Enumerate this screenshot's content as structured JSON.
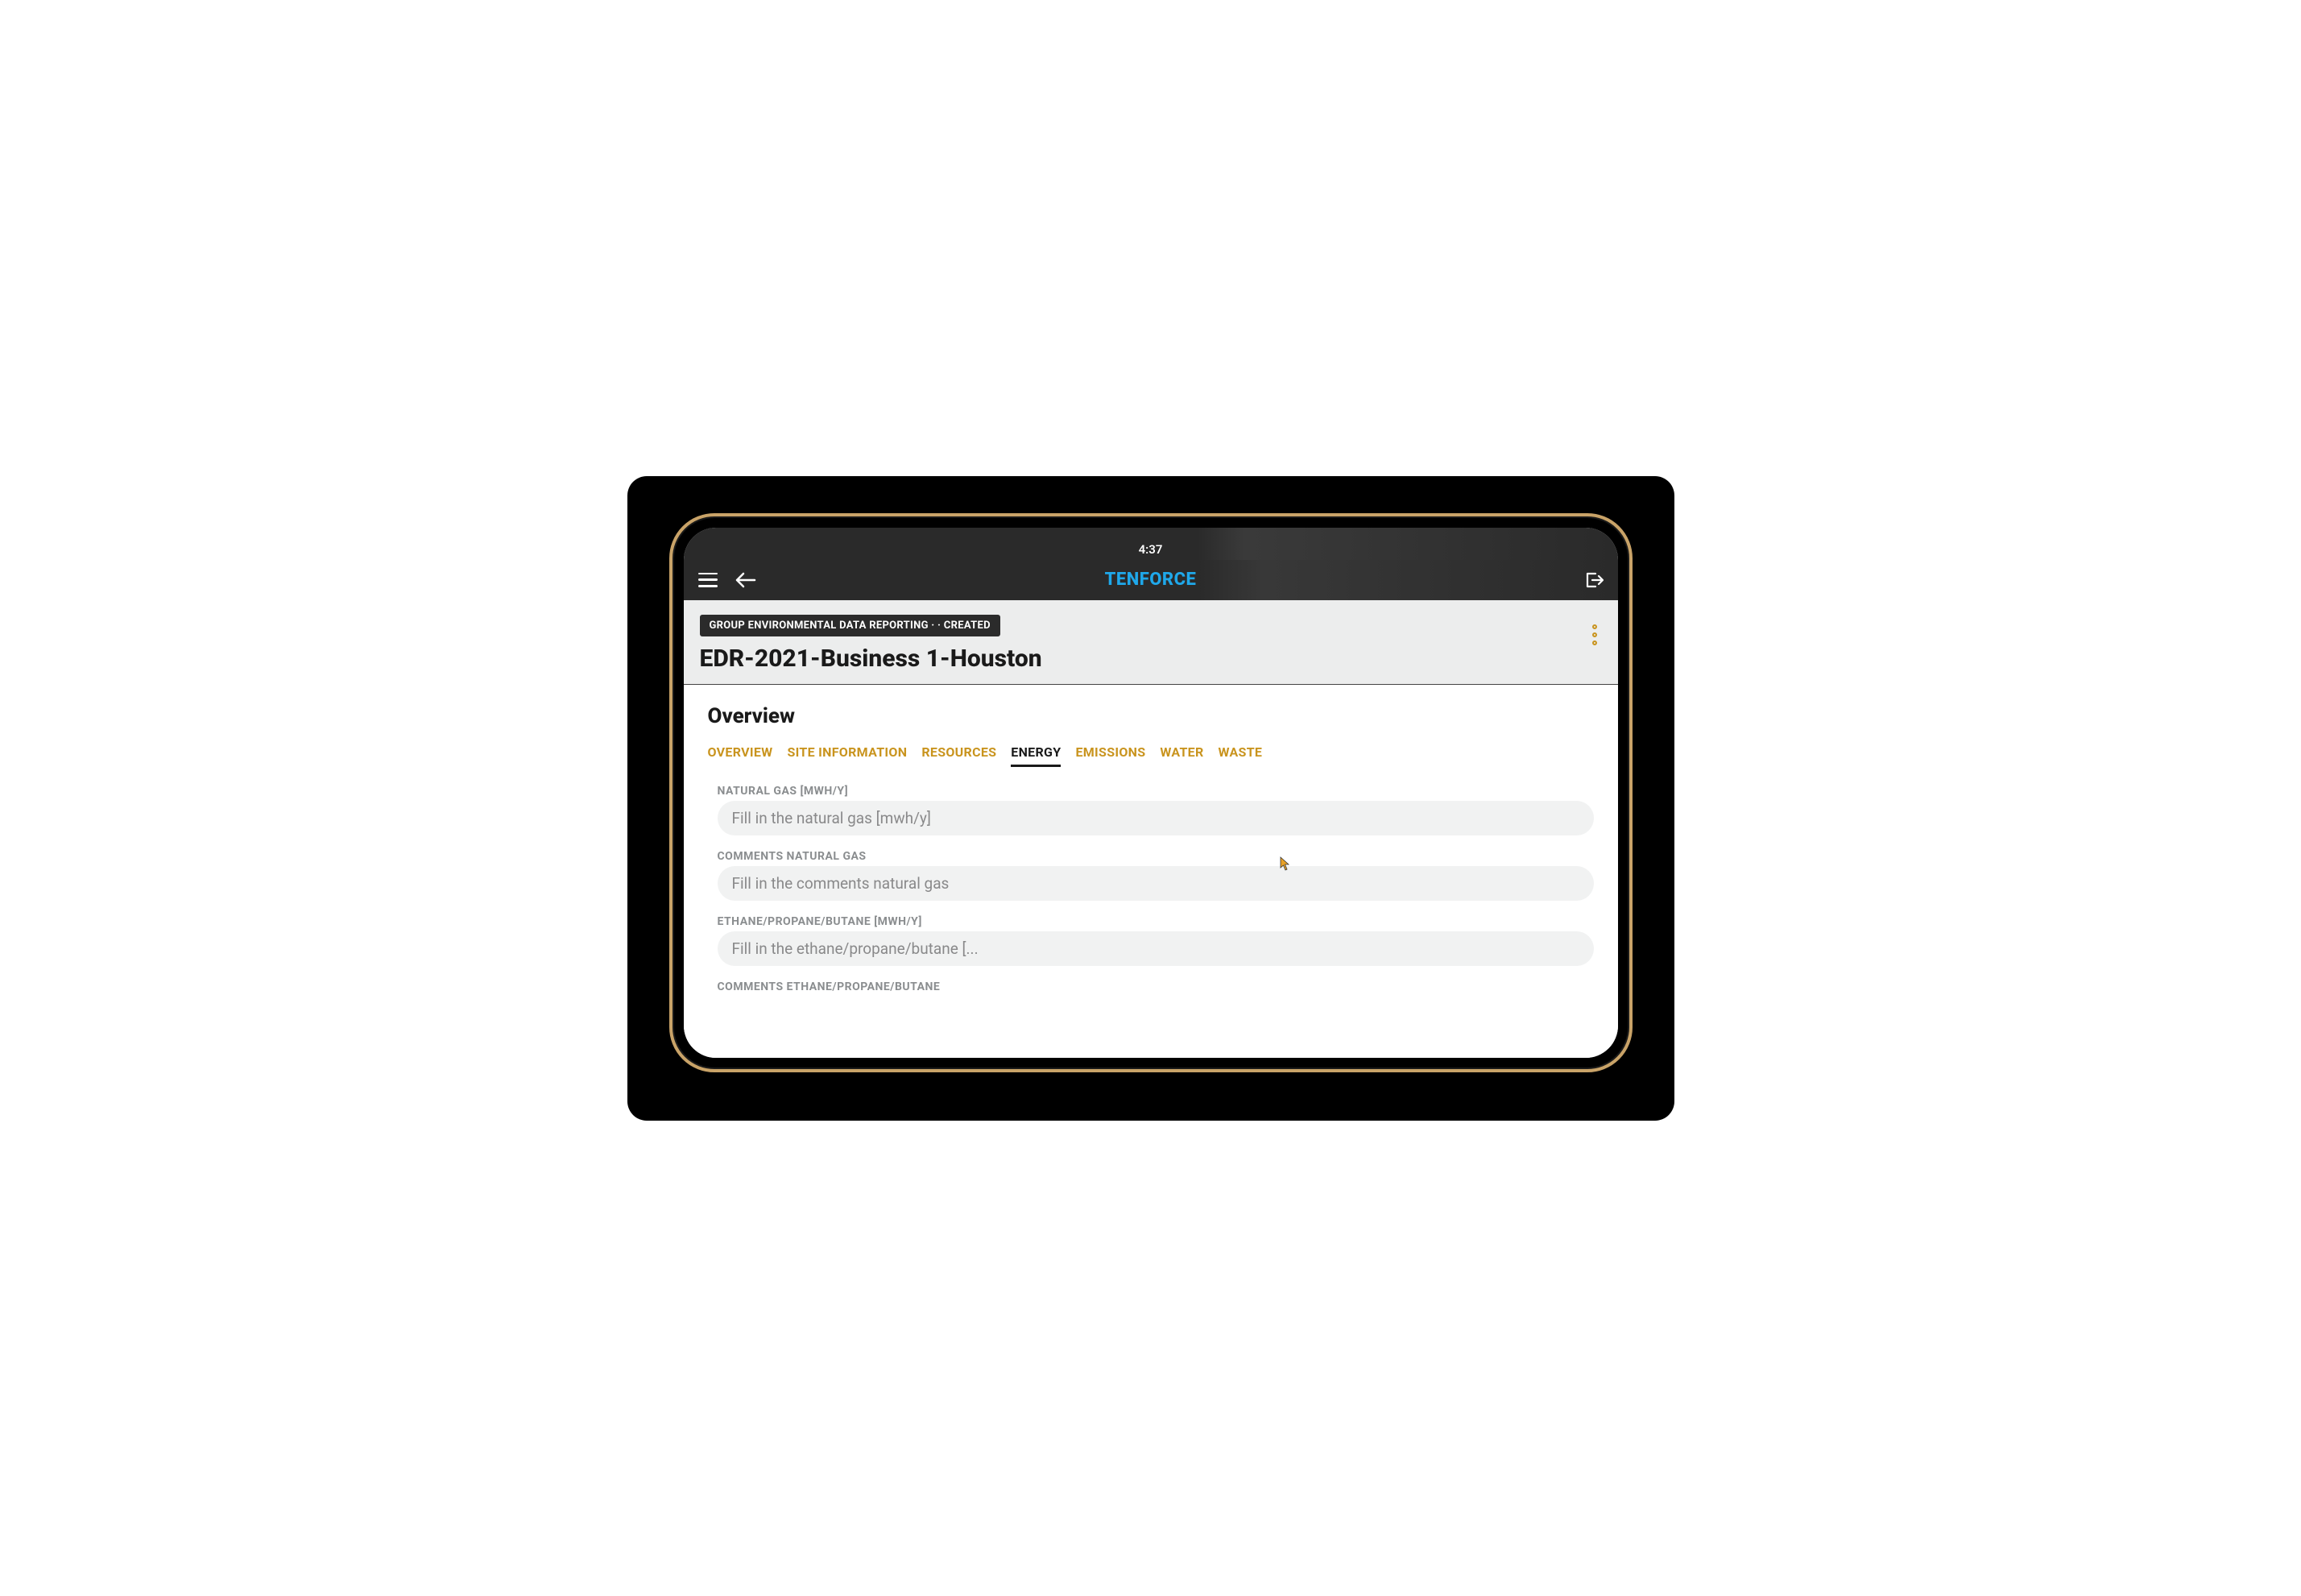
{
  "status": {
    "time": "4:37"
  },
  "nav": {
    "brand": "TENFORCE"
  },
  "header": {
    "breadcrumb": "GROUP ENVIRONMENTAL DATA REPORTING ·  · CREATED",
    "title": "EDR-2021-Business 1-Houston"
  },
  "section": {
    "heading": "Overview"
  },
  "tabs": [
    {
      "label": "OVERVIEW",
      "active": false
    },
    {
      "label": "SITE INFORMATION",
      "active": false
    },
    {
      "label": "RESOURCES",
      "active": false
    },
    {
      "label": "ENERGY",
      "active": true
    },
    {
      "label": "EMISSIONS",
      "active": false
    },
    {
      "label": "WATER",
      "active": false
    },
    {
      "label": "WASTE",
      "active": false
    }
  ],
  "fields": [
    {
      "label": "NATURAL GAS [MWH/Y]",
      "placeholder": "Fill in the natural gas [mwh/y]",
      "value": ""
    },
    {
      "label": "COMMENTS NATURAL GAS",
      "placeholder": "Fill in the comments natural gas",
      "value": ""
    },
    {
      "label": "ETHANE/PROPANE/BUTANE [MWH/Y]",
      "placeholder": "Fill in the ethane/propane/butane [...",
      "value": ""
    },
    {
      "label": "COMMENTS ETHANE/PROPANE/BUTANE",
      "placeholder": "",
      "value": ""
    }
  ]
}
